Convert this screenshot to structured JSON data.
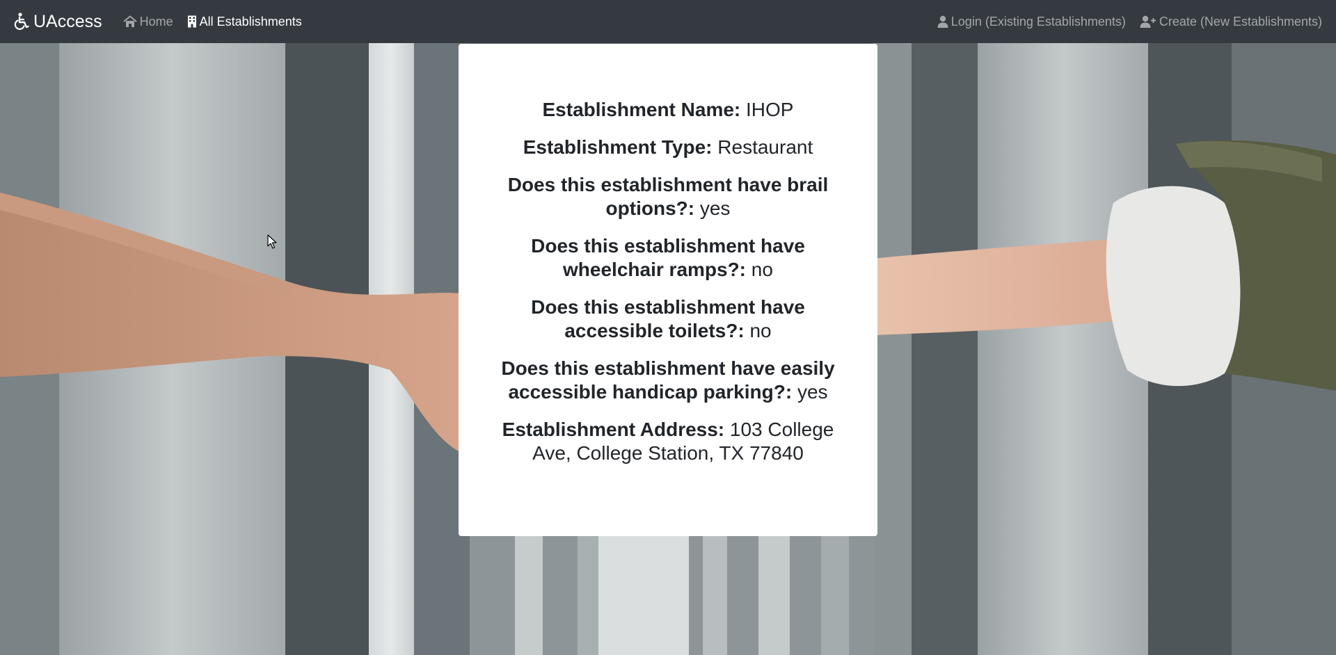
{
  "nav": {
    "brand": "UAccess",
    "home": "Home",
    "all_establishments": "All Establishments",
    "login": "Login (Existing Establishments)",
    "create": "Create (New Establishments)"
  },
  "establishment": {
    "name_label": "Establishment Name:",
    "name_value": "IHOP",
    "type_label": "Establishment Type:",
    "type_value": "Restaurant",
    "brail_label": "Does this establishment have brail options?:",
    "brail_value": "yes",
    "ramps_label": "Does this establishment have wheelchair ramps?:",
    "ramps_value": "no",
    "toilets_label": "Does this establishment have accessible toilets?:",
    "toilets_value": "no",
    "parking_label": "Does this establishment have easily accessible handicap parking?:",
    "parking_value": "yes",
    "address_label": "Establishment Address:",
    "address_value": "103 College Ave, College Station, TX 77840"
  },
  "icons": {
    "brand": "wheelchair-icon",
    "home": "home-icon",
    "all_establishments": "building-icon",
    "login": "user-icon",
    "create": "user-plus-icon"
  },
  "colors": {
    "navbar": "#343a40",
    "card": "#ffffff",
    "text": "#212529"
  }
}
